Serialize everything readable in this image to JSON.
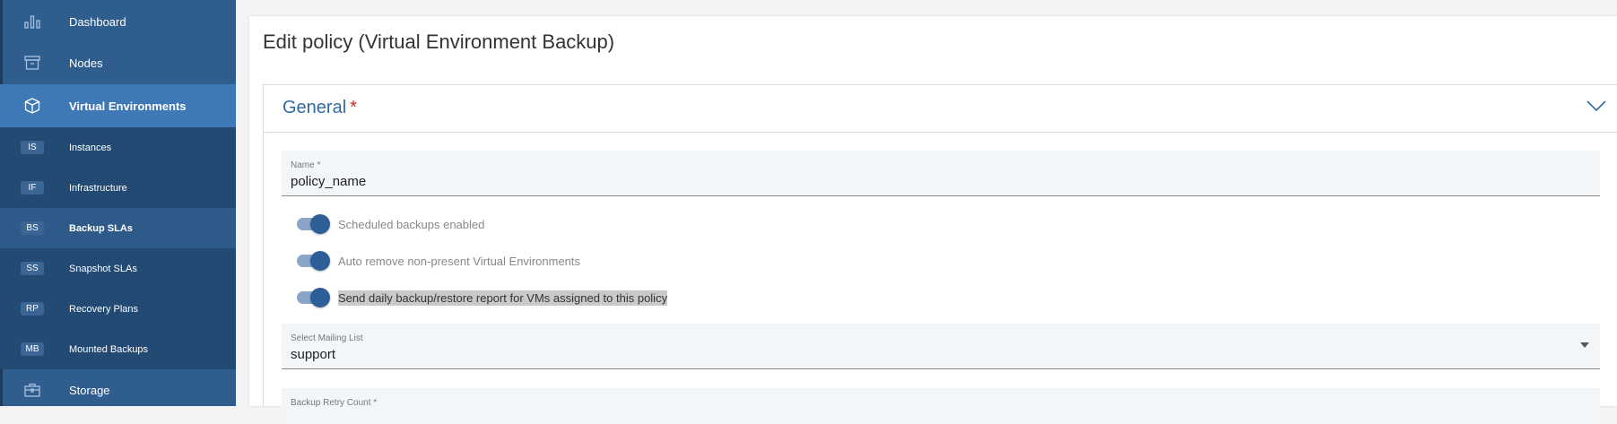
{
  "sidebar": {
    "items": [
      {
        "label": "Dashboard",
        "icon": "bar-chart-icon"
      },
      {
        "label": "Nodes",
        "icon": "archive-box-icon"
      },
      {
        "label": "Virtual Environments",
        "icon": "cube-icon",
        "active": true
      },
      {
        "label": "Storage",
        "icon": "briefcase-icon"
      }
    ],
    "subitems": [
      {
        "badge": "IS",
        "label": "Instances"
      },
      {
        "badge": "IF",
        "label": "Infrastructure"
      },
      {
        "badge": "BS",
        "label": "Backup SLAs",
        "active": true
      },
      {
        "badge": "SS",
        "label": "Snapshot SLAs"
      },
      {
        "badge": "RP",
        "label": "Recovery Plans"
      },
      {
        "badge": "MB",
        "label": "Mounted Backups"
      }
    ]
  },
  "page": {
    "title": "Edit policy (Virtual Environment Backup)"
  },
  "section": {
    "title": "General",
    "required_mark": "*"
  },
  "form": {
    "name": {
      "label": "Name *",
      "value": "policy_name"
    },
    "toggles": [
      {
        "label": "Scheduled backups enabled",
        "on": true
      },
      {
        "label": "Auto remove non-present Virtual Environments",
        "on": true
      },
      {
        "label": "Send daily backup/restore report for VMs assigned to this policy",
        "on": true
      }
    ],
    "mailing_list": {
      "label": "Select Mailing List",
      "value": "support"
    },
    "retry_count": {
      "label": "Backup Retry Count *"
    }
  },
  "colors": {
    "sidebar": "#2f5d8e",
    "sidebar_active": "#3f78b7",
    "subgroup": "#234a72",
    "accent": "#2f6aa3",
    "required": "#c62828"
  }
}
